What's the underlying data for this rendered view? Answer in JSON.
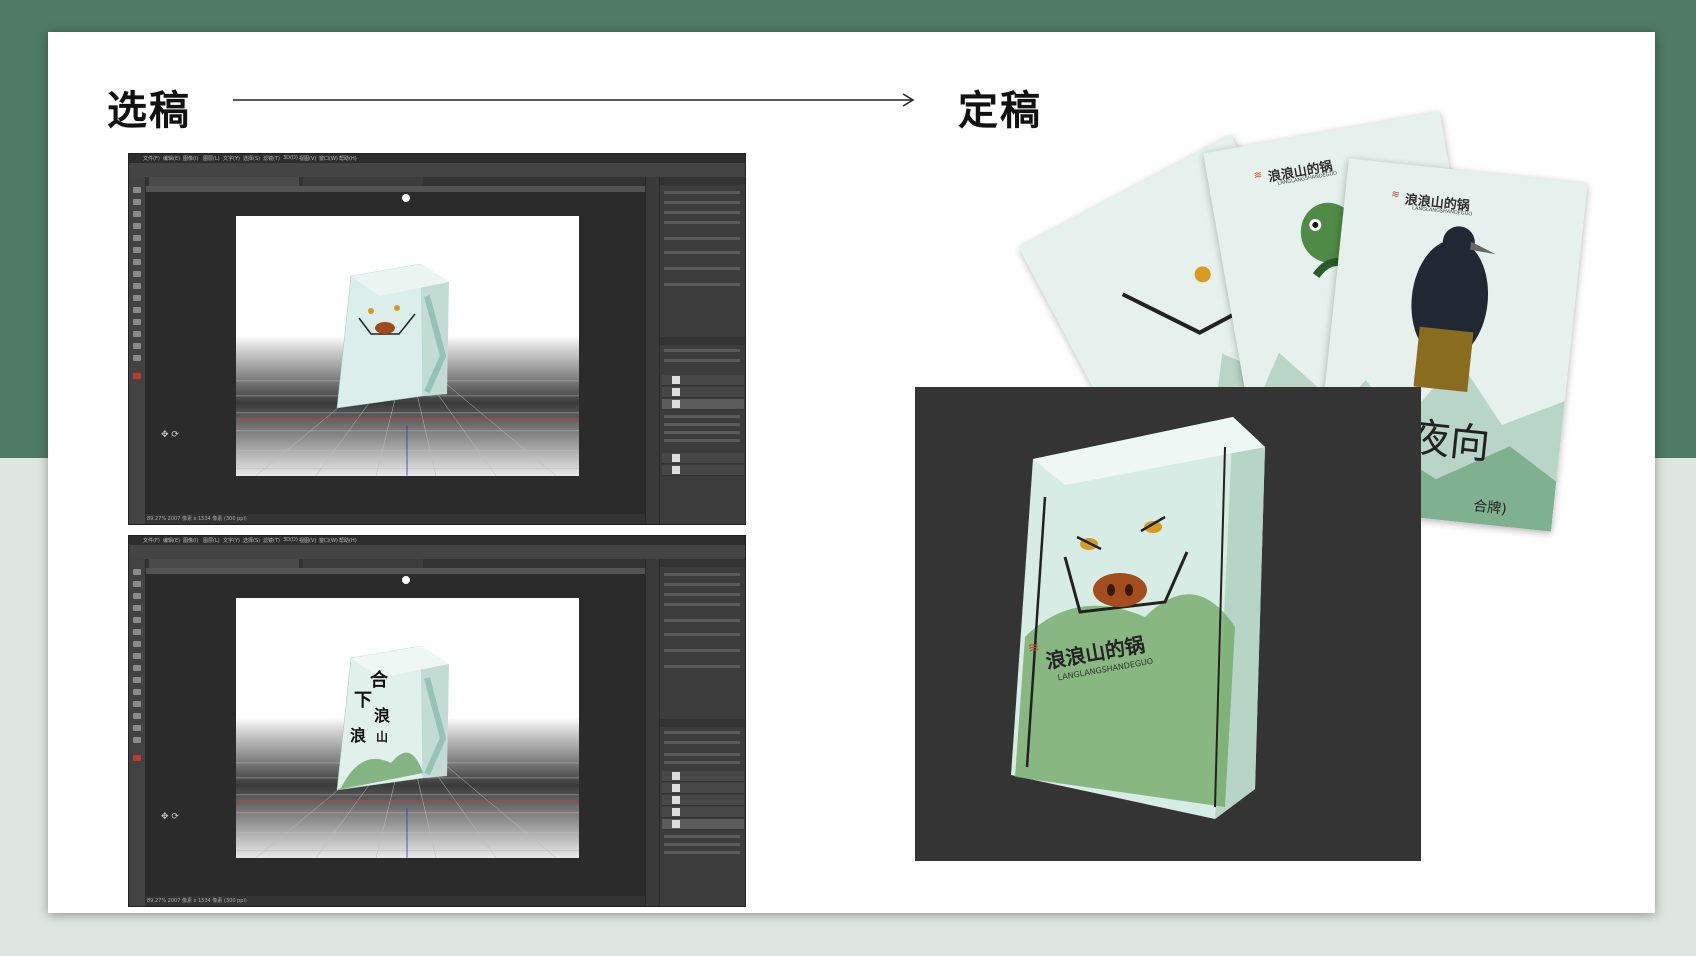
{
  "slide": {
    "left_heading": "选稿",
    "right_heading": "定稿"
  },
  "ps_window_1": {
    "menu": [
      "文件(F)",
      "编辑(E)",
      "图像(I)",
      "图层(L)",
      "文字(Y)",
      "选择(S)",
      "滤镜(T)",
      "3D(D)",
      "视图(V)",
      "窗口(W)",
      "帮助(H)"
    ],
    "status": "89.27%   2007 像素 x 1534 像素 (300 ppi)"
  },
  "ps_window_2": {
    "menu": [
      "文件(F)",
      "编辑(E)",
      "图像(I)",
      "图层(L)",
      "文字(Y)",
      "选择(S)",
      "滤镜(T)",
      "3D(D)",
      "视图(V)",
      "窗口(W)",
      "帮助(H)"
    ],
    "status": "89.27%   2007 像素 x 1534 像素 (300 ppi)",
    "box_title_chars": [
      "合",
      "下",
      "浪",
      "浪",
      "山"
    ]
  },
  "final_product": {
    "brand_cn": "浪浪山的锅",
    "brand_en": "LANGLANGSHANDEGUO",
    "card_text_1": "夜向",
    "card_text_2": "合牌)"
  },
  "colors": {
    "frame_green": "#4e7a66",
    "frame_light": "#dfe6e0",
    "ps_bg": "#3b3b3b",
    "photo_bg": "#343434",
    "accent_red": "#c3472b"
  }
}
